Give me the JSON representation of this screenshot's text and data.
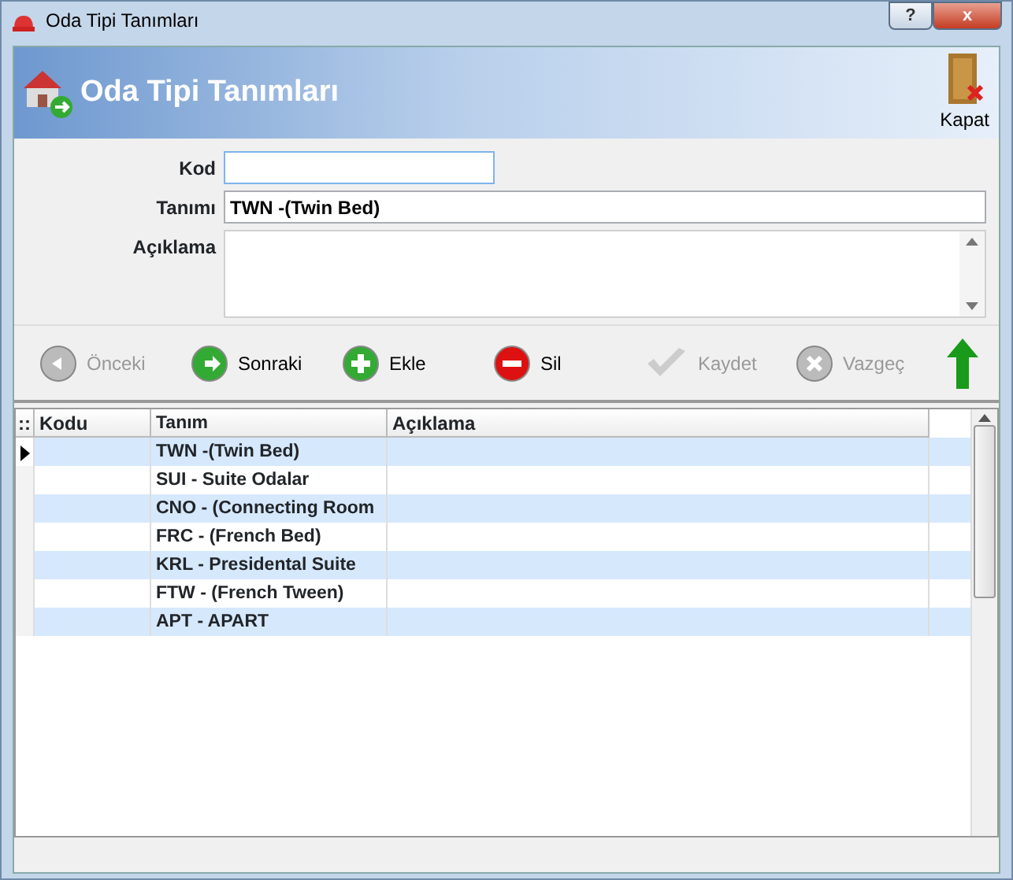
{
  "window": {
    "title": "Oda Tipi Tanımları",
    "buttons": [
      "?",
      "x"
    ]
  },
  "header": {
    "title": "Oda Tipi Tanımları",
    "close_label": "Kapat"
  },
  "form": {
    "fields": [
      {
        "label": "Kod",
        "kind": "short"
      },
      {
        "label": "Tanımı",
        "value": "TWN -(Twin Bed)",
        "kind": "line"
      },
      {
        "label": "Açıklama",
        "kind": "memo"
      }
    ]
  },
  "toolbar": [
    {
      "label": "Önceki",
      "kind": "prev",
      "disabled": true
    },
    {
      "label": "Sonraki",
      "kind": "next",
      "disabled": false
    },
    {
      "label": "Ekle",
      "kind": "add",
      "disabled": false
    },
    {
      "label": "Sil",
      "kind": "delete",
      "disabled": false
    },
    {
      "label": "Kaydet",
      "kind": "save",
      "disabled": true
    },
    {
      "label": "Vazgeç",
      "kind": "cancel",
      "disabled": true
    },
    {
      "kind": "up",
      "disabled": false
    }
  ],
  "table": {
    "corner": "::",
    "columns": [
      "Kodu",
      "Tanım",
      "Açıklama"
    ],
    "rows": [
      {
        "tanim": "TWN -(Twin Bed)",
        "selected": true
      },
      {
        "tanim": "SUI - Suite Odalar",
        "selected": false
      },
      {
        "tanim": "CNO - (Connecting Room",
        "selected": false
      },
      {
        "tanim": "FRC - (French Bed)",
        "selected": false
      },
      {
        "tanim": "KRL - Presidental Suite",
        "selected": false
      },
      {
        "tanim": "FTW - (French Tween)",
        "selected": false
      },
      {
        "tanim": "APT - APART",
        "selected": false
      }
    ]
  }
}
